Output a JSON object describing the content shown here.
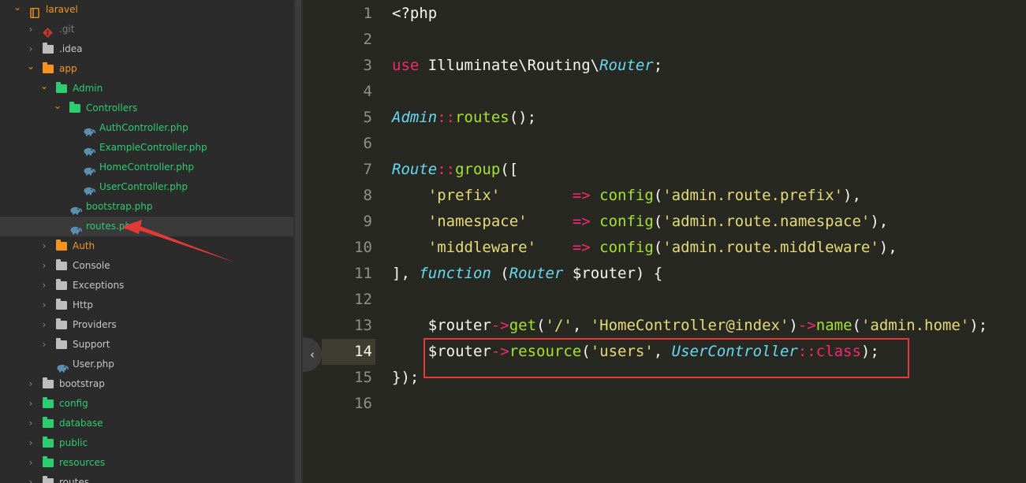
{
  "sidebar": {
    "items": [
      {
        "label": "laravel",
        "icon": "project-icon",
        "color": "orange",
        "chevron": "open"
      },
      {
        "label": ".git",
        "icon": "git-icon",
        "color": "dim",
        "chevron": "closed"
      },
      {
        "label": ".idea",
        "icon": "folder-icon",
        "color": "gray",
        "chevron": "closed"
      },
      {
        "label": "app",
        "icon": "folder-icon",
        "color": "orange",
        "chevron": "open"
      },
      {
        "label": "Admin",
        "icon": "folder-icon",
        "color": "green",
        "chevron": "open"
      },
      {
        "label": "Controllers",
        "icon": "folder-icon",
        "color": "green",
        "chevron": "open"
      },
      {
        "label": "AuthController.php",
        "icon": "php-file-icon",
        "color": "green"
      },
      {
        "label": "ExampleController.php",
        "icon": "php-file-icon",
        "color": "green"
      },
      {
        "label": "HomeController.php",
        "icon": "php-file-icon",
        "color": "green"
      },
      {
        "label": "UserController.php",
        "icon": "php-file-icon",
        "color": "green"
      },
      {
        "label": "bootstrap.php",
        "icon": "php-file-icon",
        "color": "green"
      },
      {
        "label": "routes.php",
        "icon": "php-file-icon",
        "color": "green",
        "selected": true
      },
      {
        "label": "Auth",
        "icon": "folder-icon",
        "color": "orange",
        "chevron": "closed"
      },
      {
        "label": "Console",
        "icon": "folder-icon",
        "color": "gray",
        "chevron": "closed"
      },
      {
        "label": "Exceptions",
        "icon": "folder-icon",
        "color": "gray",
        "chevron": "closed"
      },
      {
        "label": "Http",
        "icon": "folder-icon",
        "color": "gray",
        "chevron": "closed"
      },
      {
        "label": "Providers",
        "icon": "folder-icon",
        "color": "gray",
        "chevron": "closed"
      },
      {
        "label": "Support",
        "icon": "folder-icon",
        "color": "gray",
        "chevron": "closed"
      },
      {
        "label": "User.php",
        "icon": "php-file-icon",
        "color": "gray"
      },
      {
        "label": "bootstrap",
        "icon": "folder-icon",
        "color": "gray",
        "chevron": "closed"
      },
      {
        "label": "config",
        "icon": "folder-icon",
        "color": "green",
        "chevron": "closed"
      },
      {
        "label": "database",
        "icon": "folder-icon",
        "color": "green",
        "chevron": "closed"
      },
      {
        "label": "public",
        "icon": "folder-icon",
        "color": "green",
        "chevron": "closed"
      },
      {
        "label": "resources",
        "icon": "folder-icon",
        "color": "green",
        "chevron": "closed"
      },
      {
        "label": "routes",
        "icon": "folder-icon",
        "color": "gray",
        "chevron": "closed"
      }
    ]
  },
  "editor": {
    "active_line": 14,
    "line_numbers": [
      "1",
      "2",
      "3",
      "4",
      "5",
      "6",
      "7",
      "8",
      "9",
      "10",
      "11",
      "12",
      "13",
      "14",
      "15",
      "16"
    ],
    "lines": [
      [
        [
          "p",
          "<?php"
        ]
      ],
      [],
      [
        [
          "k",
          "use"
        ],
        [
          "p",
          " Illuminate\\Routing\\"
        ],
        [
          "t",
          "Router"
        ],
        [
          "p",
          ";"
        ]
      ],
      [],
      [
        [
          "t",
          "Admin"
        ],
        [
          "k",
          "::"
        ],
        [
          "f",
          "routes"
        ],
        [
          "p",
          "();"
        ]
      ],
      [],
      [
        [
          "t",
          "Route"
        ],
        [
          "k",
          "::"
        ],
        [
          "f",
          "group"
        ],
        [
          "p",
          "(["
        ]
      ],
      [
        [
          "p",
          "    "
        ],
        [
          "s",
          "'prefix'"
        ],
        [
          "p",
          "        "
        ],
        [
          "k",
          "=>"
        ],
        [
          "p",
          " "
        ],
        [
          "f",
          "config"
        ],
        [
          "p",
          "("
        ],
        [
          "s",
          "'admin.route.prefix'"
        ],
        [
          "p",
          "),"
        ]
      ],
      [
        [
          "p",
          "    "
        ],
        [
          "s",
          "'namespace'"
        ],
        [
          "p",
          "     "
        ],
        [
          "k",
          "=>"
        ],
        [
          "p",
          " "
        ],
        [
          "f",
          "config"
        ],
        [
          "p",
          "("
        ],
        [
          "s",
          "'admin.route.namespace'"
        ],
        [
          "p",
          "),"
        ]
      ],
      [
        [
          "p",
          "    "
        ],
        [
          "s",
          "'middleware'"
        ],
        [
          "p",
          "    "
        ],
        [
          "k",
          "=>"
        ],
        [
          "p",
          " "
        ],
        [
          "f",
          "config"
        ],
        [
          "p",
          "("
        ],
        [
          "s",
          "'admin.route.middleware'"
        ],
        [
          "p",
          "),"
        ]
      ],
      [
        [
          "p",
          "], "
        ],
        [
          "t",
          "function"
        ],
        [
          "p",
          " ("
        ],
        [
          "t",
          "Router"
        ],
        [
          "p",
          " $router) {"
        ]
      ],
      [],
      [
        [
          "p",
          "    $router"
        ],
        [
          "k",
          "->"
        ],
        [
          "f",
          "get"
        ],
        [
          "p",
          "("
        ],
        [
          "s",
          "'/'"
        ],
        [
          "p",
          ", "
        ],
        [
          "s",
          "'HomeController@index'"
        ],
        [
          "p",
          ")"
        ],
        [
          "k",
          "->"
        ],
        [
          "f",
          "name"
        ],
        [
          "p",
          "("
        ],
        [
          "s",
          "'admin.home'"
        ],
        [
          "p",
          ");"
        ]
      ],
      [
        [
          "p",
          "    $router"
        ],
        [
          "k",
          "->"
        ],
        [
          "f",
          "resource"
        ],
        [
          "p",
          "("
        ],
        [
          "s",
          "'users'"
        ],
        [
          "p",
          ", "
        ],
        [
          "t",
          "UserController"
        ],
        [
          "k",
          "::"
        ],
        [
          "k",
          "class"
        ],
        [
          "p",
          ");"
        ]
      ],
      [
        [
          "p",
          "});"
        ]
      ],
      []
    ]
  },
  "colors": {
    "editor_bg": "#272822",
    "sidebar_bg": "#2b2b2b",
    "keyword": "#f92672",
    "type": "#66d9ef",
    "function": "#a6e22e",
    "string": "#e6db74",
    "annotation_red": "#e53935"
  }
}
